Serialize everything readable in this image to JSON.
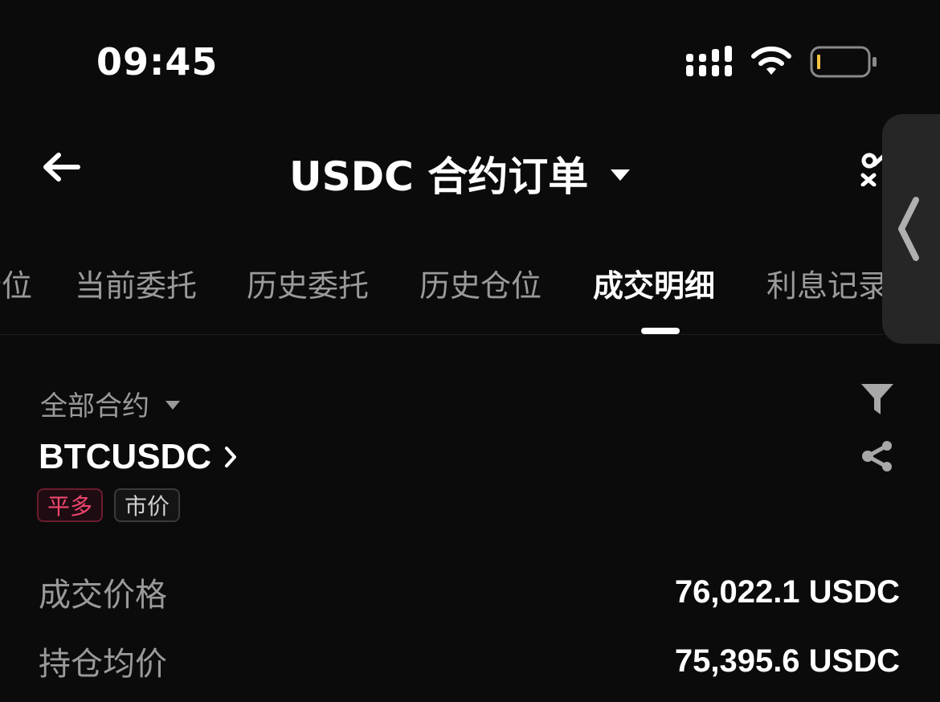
{
  "status_bar": {
    "time": "09:45",
    "icons": [
      "signal-icon",
      "wifi-icon",
      "battery-icon"
    ]
  },
  "header": {
    "title": "USDC 合约订单",
    "back_icon": "arrow-left-icon",
    "title_dropdown_icon": "caret-down-icon",
    "tool_icon": "tool-icon"
  },
  "tabs": [
    {
      "label": "仓位",
      "active": false
    },
    {
      "label": "当前委托",
      "active": false
    },
    {
      "label": "历史委托",
      "active": false
    },
    {
      "label": "历史仓位",
      "active": false
    },
    {
      "label": "成交明细",
      "active": true
    },
    {
      "label": "利息记录",
      "active": false
    }
  ],
  "filter": {
    "contract_label": "全部合约",
    "filter_icon": "funnel-icon",
    "share_icon": "share-icon"
  },
  "trade": {
    "symbol": "BTCUSDC",
    "tags": {
      "side": "平多",
      "order_type": "市价"
    },
    "rows": [
      {
        "label": "成交价格",
        "value": "76,022.1 USDC"
      },
      {
        "label": "持仓均价",
        "value": "75,395.6 USDC"
      }
    ]
  },
  "colors": {
    "background": "#0b0b0b",
    "accent_red": "#f0466e",
    "muted_text": "#9a9a9a"
  }
}
